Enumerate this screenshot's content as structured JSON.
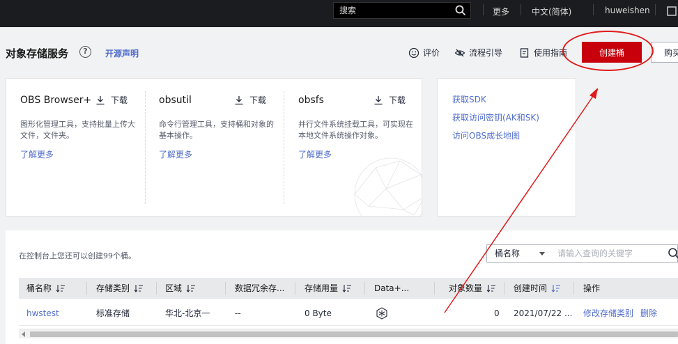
{
  "topbar": {
    "search_placeholder": "搜索",
    "more": "更多",
    "language": "中文(简体)",
    "username": "huweishen"
  },
  "header": {
    "title": "对象存储服务",
    "help_glyph": "?",
    "open_source_link": "开源声明",
    "actions": {
      "rating": "评价",
      "guide": "流程引导",
      "manual": "使用指南"
    },
    "create_bucket": "创建桶",
    "buy": "购买"
  },
  "tools": [
    {
      "name": "OBS Browser+",
      "download": "下载",
      "desc": "图形化管理工具，支持批量上传大文件，文件夹。",
      "more": "了解更多"
    },
    {
      "name": "obsutil",
      "download": "下载",
      "desc": "命令行管理工具，支持桶和对象的基本操作。",
      "more": "了解更多"
    },
    {
      "name": "obsfs",
      "download": "下载",
      "desc": "并行文件系统挂载工具，可实现在本地文件系统操作对象。",
      "more": "了解更多"
    }
  ],
  "quick_links": {
    "sdk": "获取SDK",
    "access_key": "获取访问密钥(AK和SK)",
    "growth_map": "访问OBS成长地图"
  },
  "bucket_list": {
    "quota_text": "在控制台上您还可以创建99个桶。",
    "filter": {
      "field": "桶名称",
      "placeholder": "请输入查询的关键字"
    },
    "columns": {
      "name": "桶名称",
      "storage_class": "存储类别",
      "region": "区域",
      "redundancy": "数据冗余存...",
      "usage": "存储用量",
      "data_plus": "Data+...",
      "object_count": "对象数量",
      "created": "创建时间",
      "operation": "操作"
    },
    "rows": [
      {
        "name": "hwstest",
        "storage_class": "标准存储",
        "region": "华北-北京一",
        "redundancy": "--",
        "usage": "0 Byte",
        "object_count": "0",
        "created": "2021/07/22 ...",
        "op_modify": "修改存储类别",
        "op_delete": "删除"
      }
    ]
  },
  "colors": {
    "topbar_bg": "#1b1c1f",
    "primary_red": "#c7000b",
    "link_blue": "#526ecc",
    "annotation_red": "#e01b1b"
  }
}
